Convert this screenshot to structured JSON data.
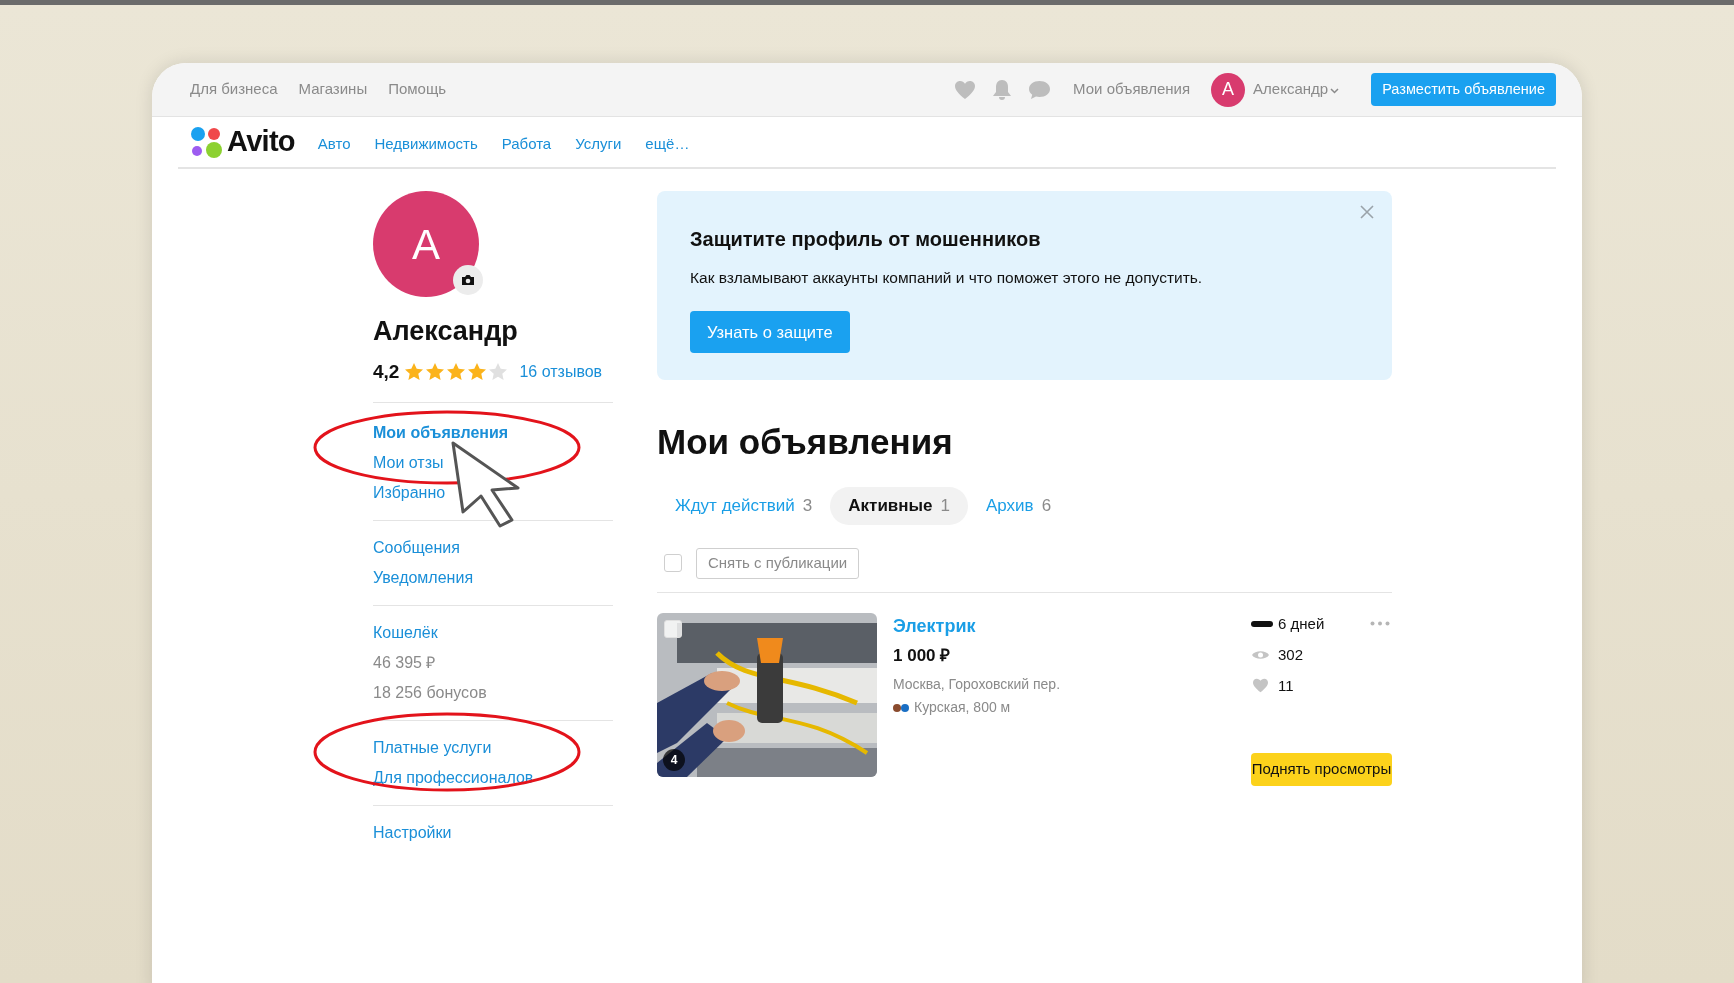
{
  "top_bar": {
    "links": [
      "Для бизнеса",
      "Магазины",
      "Помощь"
    ],
    "my_ads": "Мои объявления",
    "user": {
      "initial": "А",
      "name": "Александр"
    },
    "post_button": "Разместить объявление"
  },
  "nav": {
    "logo": "Avito",
    "categories": [
      "Авто",
      "Недвижимость",
      "Работа",
      "Услуги",
      "ещё…"
    ]
  },
  "profile": {
    "initial": "А",
    "name": "Александр",
    "rating": "4,2",
    "stars": 4,
    "reviews": "16 отзывов"
  },
  "sidebar": {
    "groups": [
      {
        "items": [
          {
            "label": "Мои объявления",
            "kind": "link",
            "selected": true
          },
          {
            "label": "Мои отзы",
            "kind": "link",
            "selected": false
          },
          {
            "label": "Избранно",
            "kind": "link",
            "selected": false
          }
        ]
      },
      {
        "items": [
          {
            "label": "Сообщения",
            "kind": "link",
            "selected": false
          },
          {
            "label": "Уведомления",
            "kind": "link",
            "selected": false
          }
        ]
      },
      {
        "items": [
          {
            "label": "Кошелёк",
            "kind": "link",
            "selected": false
          },
          {
            "label": "46 395 ₽",
            "kind": "text",
            "selected": false
          },
          {
            "label": "18 256 бонусов",
            "kind": "text",
            "selected": false
          }
        ]
      },
      {
        "items": [
          {
            "label": "Платные услуги",
            "kind": "link",
            "selected": false
          },
          {
            "label": "Для профессионалов",
            "kind": "link",
            "selected": false
          }
        ]
      },
      {
        "items": [
          {
            "label": "Настройки",
            "kind": "link",
            "selected": false
          }
        ]
      }
    ]
  },
  "banner": {
    "title": "Защитите профиль от мошенников",
    "text": "Как взламывают аккаунты компаний и что поможет этого не допустить.",
    "button": "Узнать о защите"
  },
  "heading": "Мои объявления",
  "tabs": [
    {
      "label": "Ждут действий",
      "count": "3",
      "selected": false
    },
    {
      "label": "Активные",
      "count": "1",
      "selected": true
    },
    {
      "label": "Архив",
      "count": "6",
      "selected": false
    }
  ],
  "bulk": {
    "checked": false,
    "button": "Снять с публикации"
  },
  "listings": [
    {
      "checked": false,
      "photo_count": "4",
      "title": "Электрик",
      "price": "1 000 ₽",
      "address": "Москва, Гороховский пер.",
      "metro": "Курская, 800 м",
      "metro_lines": [
        {
          "color": "#8a4b2e"
        },
        {
          "color": "#1a6fc4"
        }
      ],
      "days": "6 дней",
      "views": "302",
      "favorites": "11",
      "promote_button": "Поднять просмотры"
    }
  ]
}
